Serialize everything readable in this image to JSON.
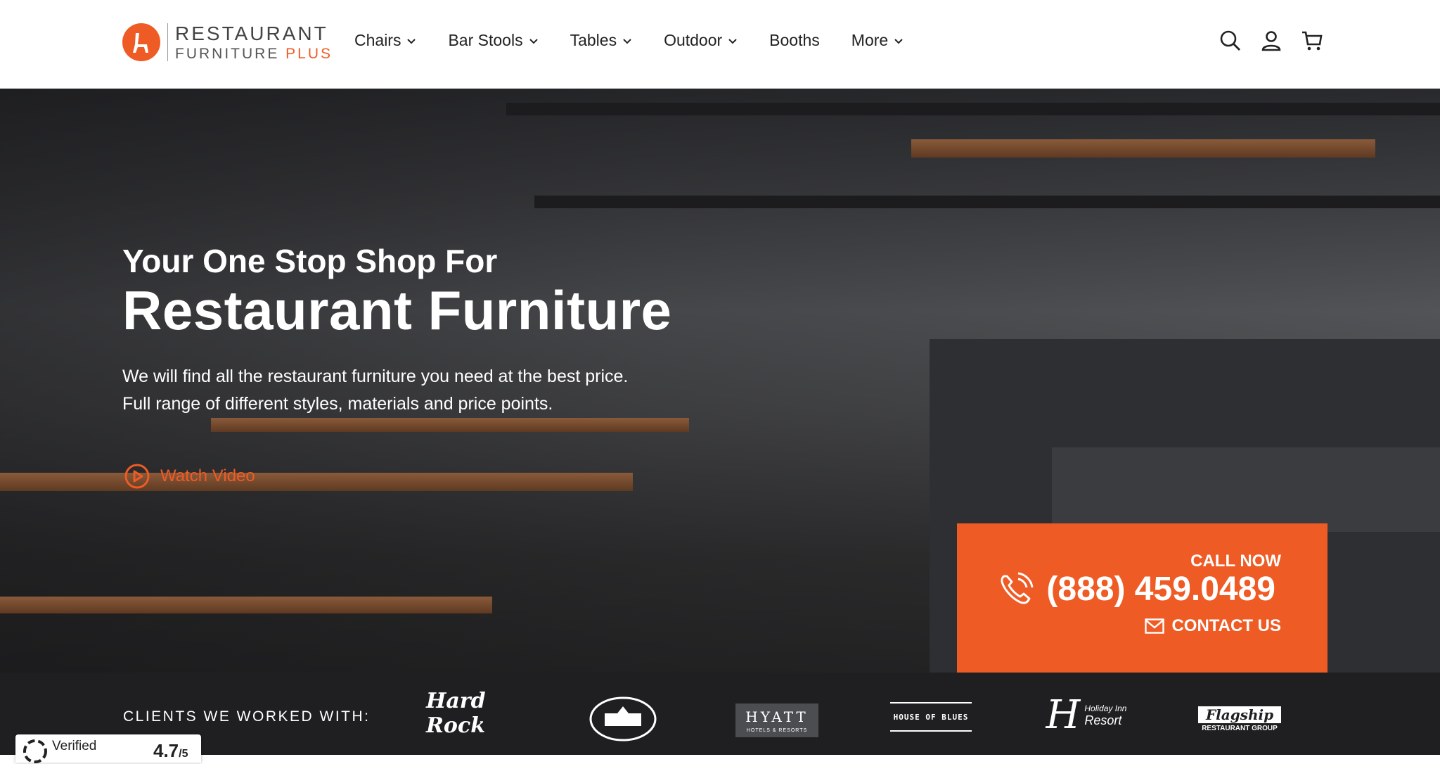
{
  "header": {
    "logo": {
      "line1": "RESTAURANT",
      "line2_a": "FURNITURE ",
      "line2_b": "PLUS"
    },
    "nav": [
      {
        "label": "Chairs",
        "has_dropdown": true
      },
      {
        "label": "Bar Stools",
        "has_dropdown": true
      },
      {
        "label": "Tables",
        "has_dropdown": true
      },
      {
        "label": "Outdoor",
        "has_dropdown": true
      },
      {
        "label": "Booths",
        "has_dropdown": false
      },
      {
        "label": "More",
        "has_dropdown": true
      }
    ],
    "icons": [
      "search-icon",
      "account-icon",
      "cart-icon"
    ]
  },
  "hero": {
    "title_small": "Your One Stop Shop For",
    "title_big": "Restaurant Furniture",
    "desc_line1": "We will find all the restaurant furniture you need at the best price.",
    "desc_line2": "Full range of different styles, materials and price points.",
    "watch_video": "Watch Video"
  },
  "callbox": {
    "call_now": "CALL NOW",
    "phone": "(888) 459.0489",
    "contact": "CONTACT US"
  },
  "clients": {
    "label": "CLIENTS WE WORKED WITH:",
    "logos": {
      "hardrock": "Hard Rock",
      "whitehouse": "THE WHITE HOUSE",
      "hyatt": "HYATT",
      "hyatt_sub": "HOTELS & RESORTS",
      "houseofblues": "HOUSE OF BLUES",
      "holidayinn_a": "Holiday Inn",
      "holidayinn_b": "Resort",
      "flagship_a": "Flagship",
      "flagship_b": "RESTAURANT GROUP"
    }
  },
  "verified": {
    "label": "Verified",
    "score": "4.7",
    "score_suffix": "/5"
  },
  "colors": {
    "accent": "#ef5b25",
    "dark_bar": "#1f1f21"
  }
}
